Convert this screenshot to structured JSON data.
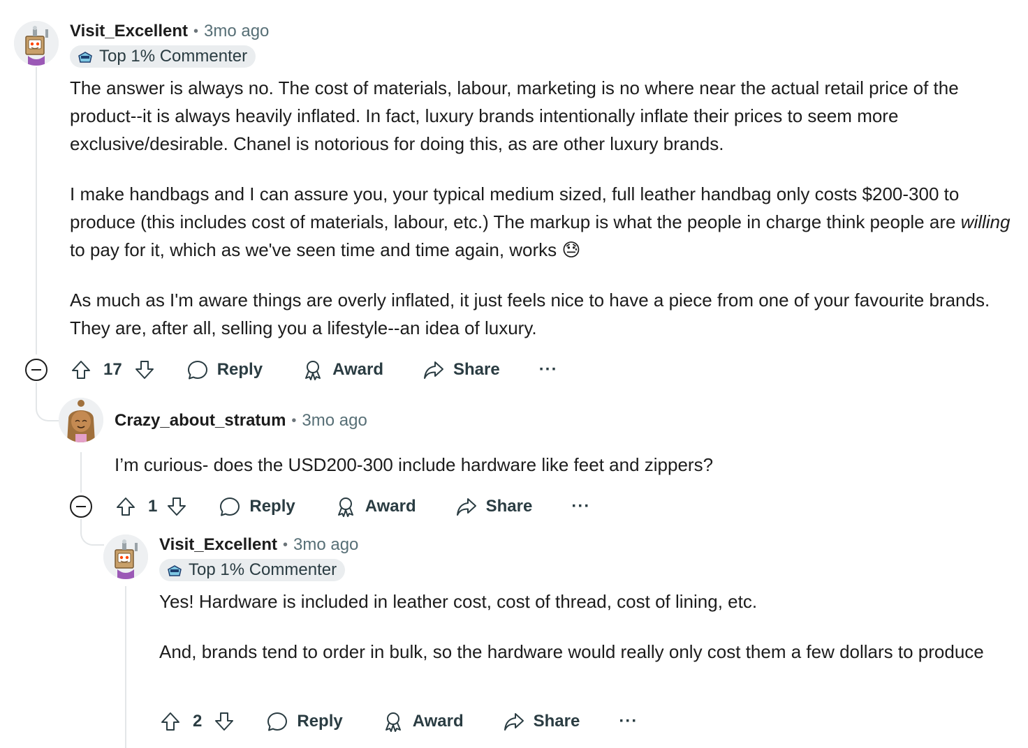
{
  "comments": [
    {
      "username": "Visit_Excellent",
      "timestamp": "3mo ago",
      "badge": "Top 1% Commenter",
      "paragraphs": [
        "The answer is always no. The cost of materials, labour, marketing is no where near the actual retail price of the product--it is always heavily inflated. In fact, luxury brands intentionally inflate their prices to seem more exclusive/desirable. Chanel is notorious for doing this, as are other luxury brands.",
        "",
        "As much as I'm aware things are overly inflated, it just feels nice to have a piece from one of your favourite brands. They are, after all, selling you a lifestyle--an idea of luxury."
      ],
      "p2_before": "I make handbags and I can assure you, your typical medium sized, full leather handbag only costs $200-300 to produce (this includes cost of materials, labour, etc.) The markup is what the people in charge think people are ",
      "p2_em": "willing",
      "p2_after": " to pay for it, which as we've seen time and time again, works ",
      "p2_emoji": "😓",
      "votes": "17",
      "reply": "Reply",
      "award": "Award",
      "share": "Share",
      "more": "···"
    },
    {
      "username": "Crazy_about_stratum",
      "timestamp": "3mo ago",
      "paragraphs": [
        "I’m curious- does the USD200-300 include hardware like feet and zippers?"
      ],
      "votes": "1",
      "reply": "Reply",
      "award": "Award",
      "share": "Share",
      "more": "···"
    },
    {
      "username": "Visit_Excellent",
      "timestamp": "3mo ago",
      "badge": "Top 1% Commenter",
      "paragraphs": [
        "Yes! Hardware is included in leather cost, cost of thread, cost of lining, etc.",
        "And, brands tend to order in bulk, so the hardware would really only cost them a few dollars to produce"
      ],
      "votes": "2",
      "reply": "Reply",
      "award": "Award",
      "share": "Share",
      "more": "···"
    }
  ],
  "icons": {
    "upvote": "upvote-arrow-icon",
    "downvote": "downvote-arrow-icon",
    "reply": "speech-bubble-icon",
    "award": "award-ribbon-icon",
    "share": "share-arrow-icon",
    "collapse": "collapse-minus-icon",
    "badge": "commenter-badge-icon"
  },
  "colors": {
    "text": "#1c1c1c",
    "meta": "#576f76",
    "badge_bg": "#eaedef",
    "thread_line": "#e3e6e8"
  }
}
